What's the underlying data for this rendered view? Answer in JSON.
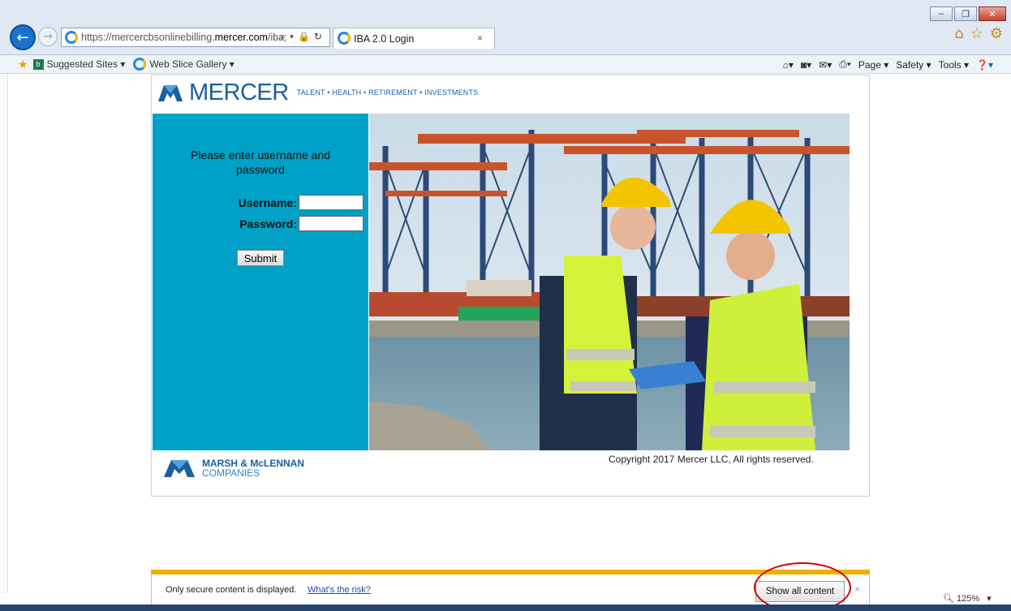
{
  "browser": {
    "url_prefix": "https://mercercbsonlinebilling.",
    "url_host": "mercer.com",
    "url_suffix": "/iba;",
    "tab_title": "IBA 2.0 Login",
    "tab_close": "×"
  },
  "favorites_bar": {
    "suggested_sites": "Suggested Sites ▾",
    "web_slice_gallery": "Web Slice Gallery ▾"
  },
  "command_bar": {
    "page": "Page ▾",
    "safety": "Safety ▾",
    "tools": "Tools ▾"
  },
  "site": {
    "brand": "MERCER",
    "tagline": "TALENT • HEALTH • RETIREMENT • INVESTMENTS"
  },
  "login": {
    "prompt": "Please enter username and password",
    "username_label": "Username:",
    "password_label": "Password:",
    "submit_label": "Submit"
  },
  "footer": {
    "parent_company_line1": "MARSH & McLENNAN",
    "parent_company_line2": "COMPANIES",
    "copyright": "Copyright 2017 Mercer LLC, All rights reserved."
  },
  "notification": {
    "message": "Only secure content is displayed.",
    "risk_link": "What's the risk?",
    "show_all_button": "Show all content",
    "close": "×"
  },
  "status": {
    "zoom": "125%"
  },
  "colors": {
    "panel": "#00a1c6",
    "brand_blue": "#1b5ea1",
    "notification_bar": "#f0b000",
    "highlight_circle": "#d60000"
  }
}
